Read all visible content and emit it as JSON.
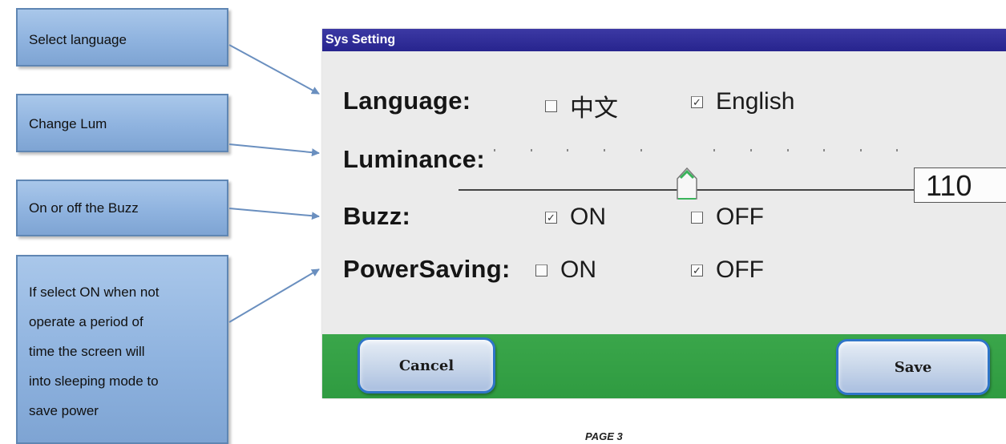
{
  "callouts": {
    "language": "Select language",
    "luminance": "Change Lum",
    "buzz": "On or off the Buzz",
    "power_saving_lines": [
      "If select ON when not",
      "operate a period of",
      "time the screen will",
      "into sleeping mode to",
      "save power"
    ]
  },
  "window": {
    "title": "Sys Setting",
    "title_bar_color": "#2b2894",
    "bottom_bar_color": "#34a145"
  },
  "language": {
    "label": "Language:",
    "options": [
      {
        "text": "中文",
        "checked": false
      },
      {
        "text": "English",
        "checked": true
      }
    ]
  },
  "luminance": {
    "label": "Luminance:",
    "value": "110",
    "slider_fraction": 0.48
  },
  "buzz": {
    "label": "Buzz:",
    "on_text": "ON",
    "on_checked": true,
    "off_text": "OFF",
    "off_checked": false
  },
  "power_saving": {
    "label": "PowerSaving:",
    "on_text": "ON",
    "on_checked": false,
    "off_text": "OFF",
    "off_checked": true
  },
  "buttons": {
    "cancel": "Cancel",
    "save": "Save"
  },
  "page_label": "PAGE 3"
}
